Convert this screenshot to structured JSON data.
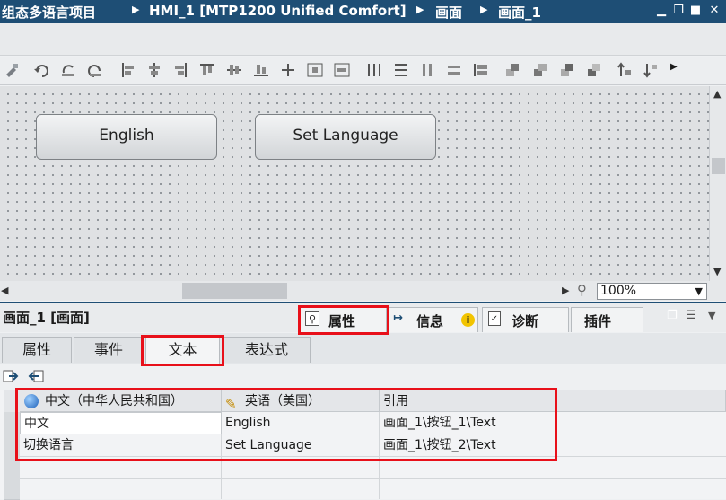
{
  "titlebar": {
    "project": "组态多语言项目",
    "device": "HMI_1 [MTP1200 Unified Comfort]",
    "folder": "画面",
    "screen": "画面_1"
  },
  "canvas": {
    "buttons": [
      "English",
      "Set Language"
    ]
  },
  "zoom": {
    "value": "100%"
  },
  "properties": {
    "object_title": "画面_1 [画面]",
    "right_tabs": {
      "properties": "属性",
      "info": "信息",
      "diagnostics": "诊断",
      "plugins": "插件"
    },
    "sub_tabs": {
      "properties": "属性",
      "events": "事件",
      "texts": "文本",
      "expressions": "表达式"
    }
  },
  "text_table": {
    "headers": [
      "中文（中华人民共和国）",
      "英语（美国）",
      "引用"
    ],
    "rows": [
      [
        "中文",
        "English",
        "画面_1\\按钮_1\\Text"
      ],
      [
        "切换语言",
        "Set Language",
        "画面_1\\按钮_2\\Text"
      ]
    ]
  },
  "colors": {
    "titlebar": "#1e4e75",
    "highlight": "#e8101a"
  }
}
